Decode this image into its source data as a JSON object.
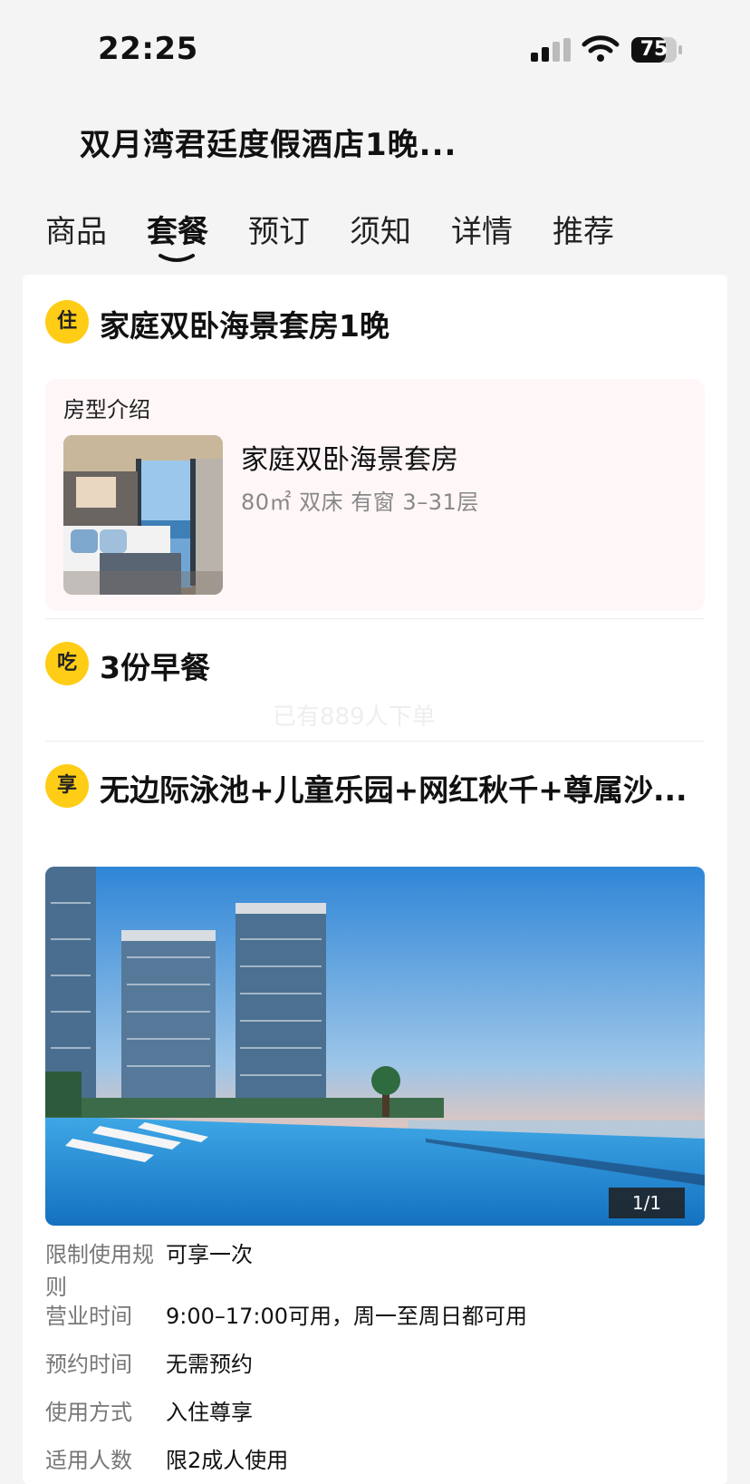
{
  "status_bar": {
    "time": "22:25",
    "battery": "75"
  },
  "header": {
    "title": "双月湾君廷度假酒店1晚..."
  },
  "tabs": [
    {
      "label": "商品"
    },
    {
      "label": "套餐",
      "active": true
    },
    {
      "label": "预订"
    },
    {
      "label": "须知"
    },
    {
      "label": "详情"
    },
    {
      "label": "推荐"
    }
  ],
  "card": {
    "stay": {
      "badge": "住",
      "title": "家庭双卧海景套房1晚",
      "room_box_label": "房型介绍",
      "room_name": "家庭双卧海景套房",
      "room_specs": "80㎡  双床  有窗  3–31层"
    },
    "eat": {
      "badge": "吃",
      "title": "3份早餐"
    },
    "watermark": "已有889人下单",
    "enjoy": {
      "badge": "享",
      "title": "无边际泳池+儿童乐园+网红秋千+尊属沙...",
      "image_counter": "1/1",
      "info": [
        {
          "key": "限制使用规则",
          "value": "可享一次"
        },
        {
          "key": "营业时间",
          "value": "9:00–17:00可用，周一至周日都可用"
        },
        {
          "key": "预约时间",
          "value": "无需预约"
        },
        {
          "key": "使用方式",
          "value": "入住尊享"
        },
        {
          "key": "适用人数",
          "value": "限2成人使用"
        }
      ]
    }
  },
  "colors": {
    "badge": "#ffcc16",
    "room_box_bg": "#fff7f7",
    "page_bg": "#f4f4f4"
  }
}
